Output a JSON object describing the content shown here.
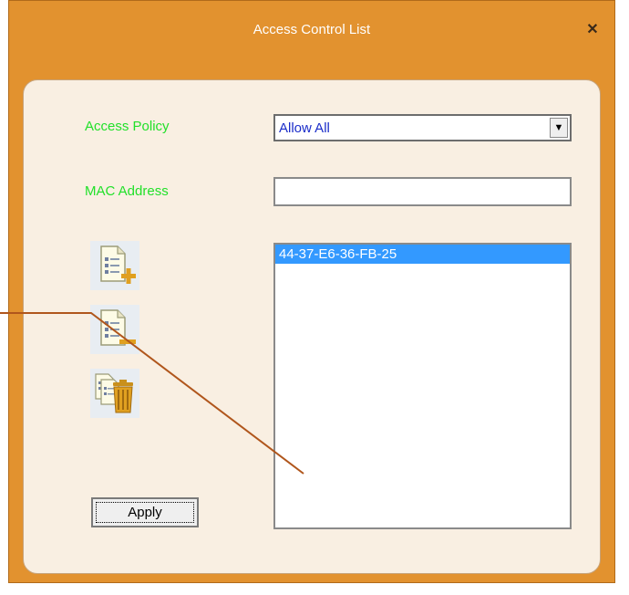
{
  "window": {
    "title": "Access Control List",
    "close_glyph": "✕"
  },
  "form": {
    "access_policy_label": "Access Policy",
    "access_policy_value": "Allow All",
    "mac_address_label": "MAC Address",
    "mac_address_value": ""
  },
  "mac_list": {
    "items": [
      "44-37-E6-36-FB-25"
    ]
  },
  "icons": [
    "add-entry-icon",
    "remove-entry-icon",
    "delete-all-icon"
  ],
  "buttons": {
    "apply_label": "Apply"
  },
  "colors": {
    "title_bar": "#e2922f",
    "panel": "#f9efe2",
    "label": "#22e02a",
    "selection": "#3399ff",
    "callout": "#b0561c"
  }
}
